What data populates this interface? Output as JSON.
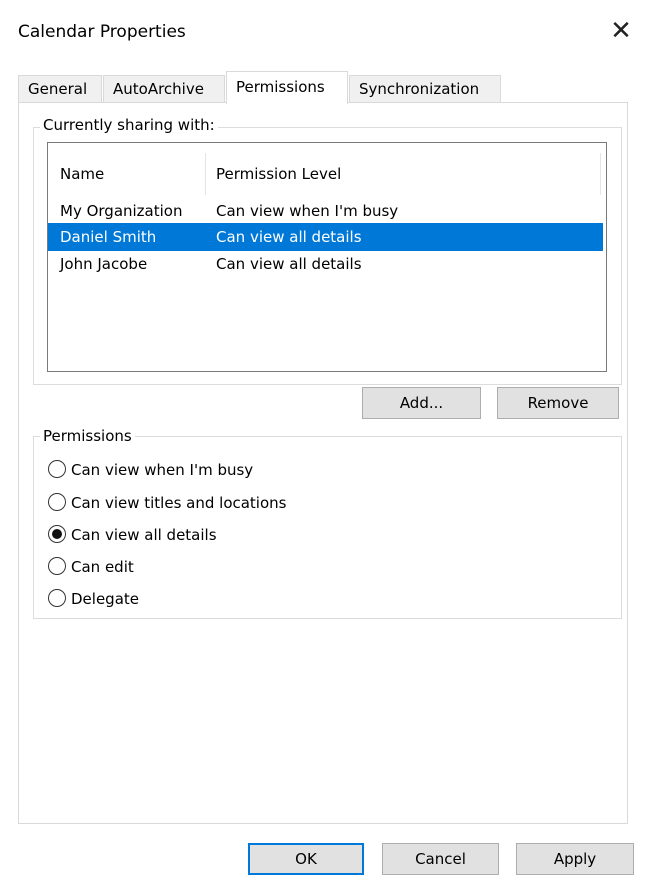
{
  "window": {
    "title": "Calendar Properties",
    "close_glyph": "✕"
  },
  "tabs": [
    {
      "label": "General",
      "active": false
    },
    {
      "label": "AutoArchive",
      "active": false
    },
    {
      "label": "Permissions",
      "active": true
    },
    {
      "label": "Synchronization",
      "active": false
    }
  ],
  "sharing": {
    "group_label": "Currently sharing with:",
    "columns": [
      "Name",
      "Permission Level"
    ],
    "rows": [
      {
        "name": "My Organization",
        "level": "Can view when I'm busy",
        "selected": false
      },
      {
        "name": "Daniel Smith",
        "level": "Can view all details",
        "selected": true
      },
      {
        "name": "John Jacobe",
        "level": "Can view all details",
        "selected": false
      }
    ],
    "selection_color": "#0078d7"
  },
  "list_buttons": {
    "add_label": "Add...",
    "remove_label": "Remove"
  },
  "permissions": {
    "group_label": "Permissions",
    "options": [
      {
        "label": "Can view when I'm busy",
        "checked": false
      },
      {
        "label": "Can view titles and locations",
        "checked": false
      },
      {
        "label": "Can view all details",
        "checked": true
      },
      {
        "label": "Can edit",
        "checked": false
      },
      {
        "label": "Delegate",
        "checked": false
      }
    ]
  },
  "footer": {
    "ok_label": "OK",
    "cancel_label": "Cancel",
    "apply_label": "Apply"
  }
}
